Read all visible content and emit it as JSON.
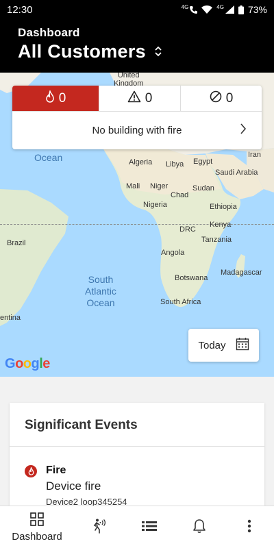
{
  "status_bar": {
    "time": "12:30",
    "network": "4G",
    "battery": "73%"
  },
  "header": {
    "subtitle": "Dashboard",
    "title": "All Customers"
  },
  "map": {
    "labels": {
      "uk": "United\nKingdom",
      "algeria": "Algeria",
      "libya": "Libya",
      "egypt": "Egypt",
      "iran": "Iran",
      "saudi": "Saudi Arabia",
      "mali": "Mali",
      "niger": "Niger",
      "chad": "Chad",
      "sudan": "Sudan",
      "nigeria": "Nigeria",
      "ethiopia": "Ethiopia",
      "drc": "DRC",
      "kenya": "Kenya",
      "tanzania": "Tanzania",
      "angola": "Angola",
      "brazil": "Brazil",
      "botswana": "Botswana",
      "madagascar": "Madagascar",
      "south_africa": "South Africa",
      "argentina": "entina",
      "ocean": "Ocean",
      "south_atlantic": "South\nAtlantic\nOcean"
    },
    "google": [
      "G",
      "o",
      "o",
      "g",
      "l",
      "e"
    ],
    "colors": {
      "water": "#aadaff",
      "land": "#f2efe6"
    }
  },
  "alarm_summary": {
    "fire_count": "0",
    "trouble_count": "0",
    "disabled_count": "0",
    "message": "No building with fire"
  },
  "today_button": {
    "label": "Today"
  },
  "events": {
    "title": "Significant Events",
    "items": [
      {
        "type": "Fire",
        "description": "Device fire",
        "location": "Device2 loop345254"
      }
    ]
  },
  "bottom_nav": {
    "items": [
      {
        "label": "Dashboard",
        "icon": "dashboard-grid-icon"
      },
      {
        "label": "",
        "icon": "walk-test-icon"
      },
      {
        "label": "",
        "icon": "list-icon"
      },
      {
        "label": "",
        "icon": "bell-icon"
      },
      {
        "label": "",
        "icon": "more-vert-icon"
      }
    ]
  },
  "colors": {
    "accent_fire": "#c4281f",
    "header_bg": "#000000"
  }
}
